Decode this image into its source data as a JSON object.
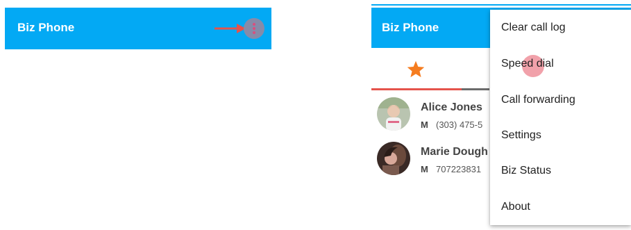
{
  "left": {
    "app_title": "Biz Phone"
  },
  "right": {
    "app_title": "Biz Phone",
    "contacts": [
      {
        "name": "Alice Jones",
        "type": "M",
        "number": "(303) 475-5"
      },
      {
        "name": "Marie Dough",
        "type": "M",
        "number": "707223831"
      }
    ]
  },
  "menu": {
    "items": [
      {
        "label": "Clear call log"
      },
      {
        "label": "Speed dial"
      },
      {
        "label": "Call forwarding"
      },
      {
        "label": "Settings"
      },
      {
        "label": "Biz Status"
      },
      {
        "label": "About"
      }
    ]
  },
  "colors": {
    "appbar": "#03A9F4",
    "accent_tab": "#e5534b",
    "star": "#F57C1F",
    "arrow": "#E5534B"
  },
  "icons": {
    "overflow": "more-vert-icon",
    "favorites_tab": "star-icon"
  }
}
